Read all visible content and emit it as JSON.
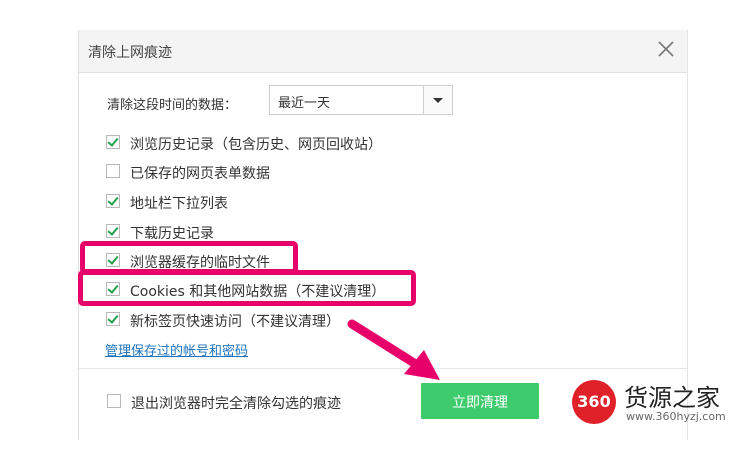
{
  "dialog": {
    "title": "清除上网痕迹",
    "range_label": "清除这段时间的数据：",
    "range_selected": "最近一天",
    "options": [
      {
        "label": "浏览历史记录（包含历史、网页回收站）",
        "checked": true
      },
      {
        "label": "已保存的网页表单数据",
        "checked": false
      },
      {
        "label": "地址栏下拉列表",
        "checked": true
      },
      {
        "label": "下载历史记录",
        "checked": true
      },
      {
        "label": "浏览器缓存的临时文件",
        "checked": true
      },
      {
        "label": "Cookies 和其他网站数据（不建议清理）",
        "checked": true
      },
      {
        "label": "新标签页快速访问（不建议清理）",
        "checked": true
      }
    ],
    "manage_link": "管理保存过的帐号和密码",
    "exit_option": {
      "label": "退出浏览器时完全清除勾选的痕迹",
      "checked": false
    },
    "clear_button": "立即清理"
  },
  "colors": {
    "accent_button": "#3ecb6e",
    "checkmark": "#23a14c",
    "highlight": "#e8006a",
    "link": "#1e73be"
  },
  "watermark": {
    "logo_text": "360",
    "name": "货源之家",
    "url": "www.360hyzj.com"
  }
}
